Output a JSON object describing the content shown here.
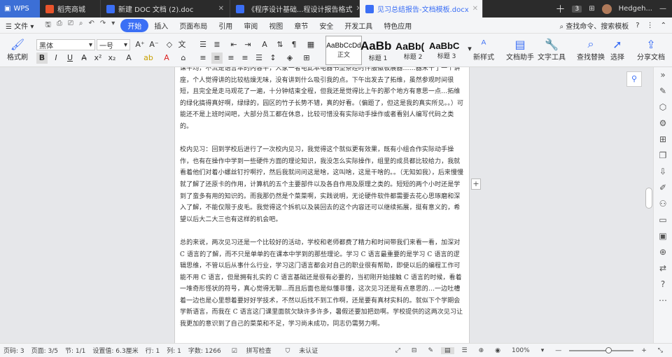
{
  "tabs": {
    "logo": "WPS",
    "items": [
      {
        "label": "稻壳商城",
        "color": "#e8542c"
      },
      {
        "label": "新建 DOC 文档 (2).doc",
        "color": "#3b6ff5"
      },
      {
        "label": "《程序设计基础...程设计报告格式",
        "color": "#3b6ff5"
      },
      {
        "label": "见习总结报告-文档模板.docx",
        "color": "#3b6ff5"
      }
    ],
    "count": "3",
    "user": "Hedgeh..."
  },
  "menu": {
    "file": "文件",
    "items": [
      "开始",
      "插入",
      "页面布局",
      "引用",
      "审阅",
      "视图",
      "章节",
      "安全",
      "开发工具",
      "特色应用"
    ],
    "search": "查找命令、搜索模板"
  },
  "ribbon": {
    "format_painter": "格式刷",
    "font": "黑体",
    "size": "一号",
    "styles": [
      {
        "sample": "AaBbCcDd",
        "label": "正文"
      },
      {
        "sample": "AaBb",
        "label": "标题 1"
      },
      {
        "sample": "AaBb(",
        "label": "标题 2"
      },
      {
        "sample": "AaBbC",
        "label": "标题 3"
      }
    ],
    "new_style": "新样式",
    "doc_helper": "文档助手",
    "text_tools": "文字工具",
    "find_replace": "查找替换",
    "select": "选择",
    "share": "分享文档"
  },
  "document": {
    "paragraphs": [
      "课平均，不流是语言本的内容平，人家一者电此本电器书型条经时件服徽板展器……器米十了一个讲座，个人觉得讲的比较枯燥无味，没有讲到什么吸引我的点。下午出发去了拓维，虽然参观时间很短，且完全是走马观花了一遍，十分钟结束全程，但我还是觉得比上午的那个地方有意思一点…拓维的绿化搞得真好啊，绿绿的，园区的竹子长势不错，真的好看。（偏题了，但这是我的真实所见。。）可能还不是上班时间吧，大部分员工都在休息，比较可惜没有实际动手操作或者看别人编写代码之类的。",
      "校内见习：回到学校后进行了一次校内见习，我觉得这个就似更有效果，既有小组合作实际动手操作，也有在操作中学到一些硬件方面的理论知识，我没怎么实际操作，组里的成员都比较给力，我就看着他们对着小螺丝钉拧啊拧，然后我就问问这是啥，这叫啥，这是干啥的。。（无知如我），后来慢慢就了解了还原卡的作用，计算机的五个主要部件以及各自作用及原理之类的。短短的两个小时还是学到了蛮多有用的知识的。而我那仍然是个菜菜啊，实践说明，无论硬件软件都需要去花心思琢磨和深入了解，不能仅限于皮毛。我觉得这个拆机以及装回去的这个内容还可以继续拓展，挺有意义的，希望以后大二大三也有这样的机会吧。",
      "总的来说，两次见习还是一个比较好的活动，学校和老师都费了精力和时间带我们来看一看，加深对 C 语言的了解，而不只是单单的在课本中学到的那些理论。学习 C 语言最重要的是学习 C 语言的逻辑思维，不管以后从事什么行业，学习这门语言都会对自己的职业很有帮助，即使以后的编程工作可能不用 C 语言，但是拥有扎实的 C 语言基础还是很有必要的，当初刚开始接触 C 语言的时候，看着一堆奇形怪状的符号，真心觉得无聊…而且后面也是似懂非懂，这次见习还是有点意思的…一边吐槽着一边也是心里想着要好好学技术，不然以后找不到工作啊，还是要有真材实料的。就似下个学期会学新语言，而我在 C 语言这门课里面就欠缺许多许多，暑假还要加把劲啊。学校提供的这两次见习让我更加的意识到了自己的菜菜和不足，学习尚未成功，同志仍需努力啊。"
    ]
  },
  "status": {
    "page": "页码: 3",
    "pages": "页面: 3/5",
    "section": "节: 1/1",
    "setting": "设置值: 6.3厘米",
    "row": "行: 1",
    "col": "列: 1",
    "words": "字数: 1266",
    "spell": "拼写检查",
    "auth": "未认证",
    "zoom": "100%"
  },
  "colors": {
    "accent": "#3b6ff5"
  }
}
